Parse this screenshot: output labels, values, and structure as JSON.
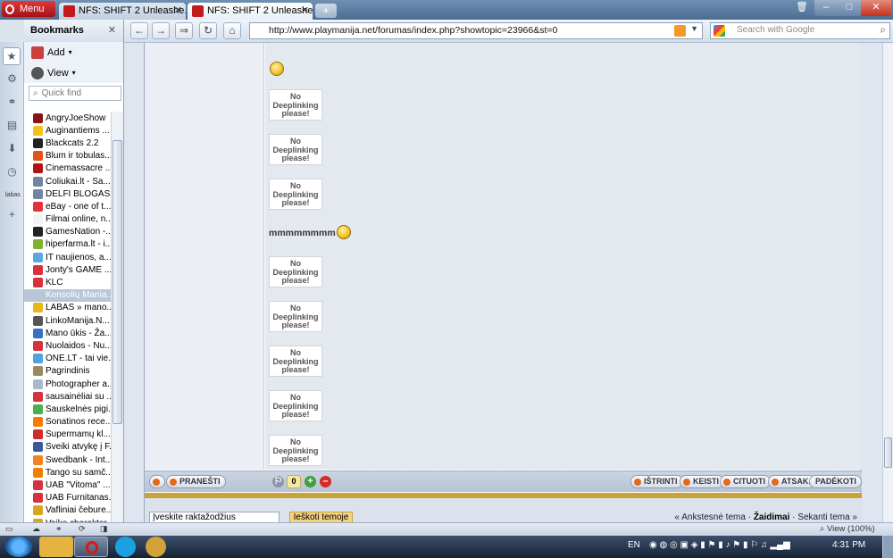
{
  "browser": {
    "menu_label": "Menu",
    "tabs": [
      {
        "title": "NFS: SHIFT 2 Unleashe..."
      },
      {
        "title": "NFS: SHIFT 2 Unleashe..."
      }
    ],
    "url": "http://www.playmanija.net/forumas/index.php?showtopic=23966&st=0",
    "search_placeholder": "Search with Google"
  },
  "bookmarks": {
    "title": "Bookmarks",
    "add_label": "Add",
    "view_label": "View",
    "quickfind_placeholder": "Quick find",
    "items": [
      {
        "label": "AngryJoeShow",
        "color": "#8a1414"
      },
      {
        "label": "Auginantiems ...",
        "color": "#f2c21b"
      },
      {
        "label": "Blackcats 2.2",
        "color": "#222222"
      },
      {
        "label": "Blum ir tobulas...",
        "color": "#e8501b"
      },
      {
        "label": "Cinemassacre ...",
        "color": "#b3120f"
      },
      {
        "label": "Coliukai.lt - Sa...",
        "color": "#6f85a3"
      },
      {
        "label": "DELFI BLOGAS ...",
        "color": "#6f85a3"
      },
      {
        "label": "eBay - one of t...",
        "color": "#e53238"
      },
      {
        "label": "Filmai online, n...",
        "color": "#f3f3f3"
      },
      {
        "label": "GamesNation -...",
        "color": "#222222"
      },
      {
        "label": "hiperfarma.lt - i...",
        "color": "#7fb32d"
      },
      {
        "label": "IT naujienos, a...",
        "color": "#58a9e2"
      },
      {
        "label": "Jonty's GAME ...",
        "color": "#d7313d"
      },
      {
        "label": "KLC",
        "color": "#d7313d"
      },
      {
        "label": "Konsolių Mania...",
        "color": "#b9c6d8",
        "selected": true
      },
      {
        "label": "LABAS » mano...",
        "color": "#e7b814"
      },
      {
        "label": "LinkoManija.N...",
        "color": "#555555"
      },
      {
        "label": "Mano ūkis - Ža...",
        "color": "#3b6fc4"
      },
      {
        "label": "Nuolaidos - Nu...",
        "color": "#d7313d"
      },
      {
        "label": "ONE.LT - tai vie...",
        "color": "#4fa3e0"
      },
      {
        "label": "Pagrindinis",
        "color": "#9a8a60"
      },
      {
        "label": "Photographer a...",
        "color": "#a8b8c8"
      },
      {
        "label": "sausainėliai su ...",
        "color": "#d7313d"
      },
      {
        "label": "Sauskelnės pigi...",
        "color": "#4bae4f"
      },
      {
        "label": "Sonatinos rece...",
        "color": "#f57d00"
      },
      {
        "label": "Supermamų kl...",
        "color": "#d12a2a"
      },
      {
        "label": "Sveiki atvykę į F...",
        "color": "#3b5998"
      },
      {
        "label": "Swedbank - Int...",
        "color": "#f58220"
      },
      {
        "label": "Tango su samč...",
        "color": "#f57d00"
      },
      {
        "label": "UAB \"Vitoma\" ...",
        "color": "#d7313d"
      },
      {
        "label": "UAB Furnitanas...",
        "color": "#d7313d"
      },
      {
        "label": "Vafliniai čebure...",
        "color": "#d9a520"
      },
      {
        "label": "Vaiko charakter...",
        "color": "#d9a520"
      }
    ]
  },
  "post": {
    "nodeeplink_text": "No Deeplinking please!",
    "message_text": "mmmmmmmm",
    "action_buttons": [
      "IŠTRINTI",
      "KEISTI",
      "CITUOTI",
      "ATSAK.",
      "PADĖKOTI"
    ],
    "report_label": "PRANEŠTI",
    "rep_count": "0"
  },
  "footer": {
    "keyword_placeholder": "Įveskite raktažodžius",
    "search_button": "Ieškoti temoje",
    "prev_topic": "« Ankstesnė tema",
    "category": "Žaidimai",
    "next_topic": "Sekanti tema »"
  },
  "statusbar": {
    "zoom": "View (100%)"
  },
  "taskbar": {
    "lang": "EN",
    "time": "4:31 PM"
  }
}
